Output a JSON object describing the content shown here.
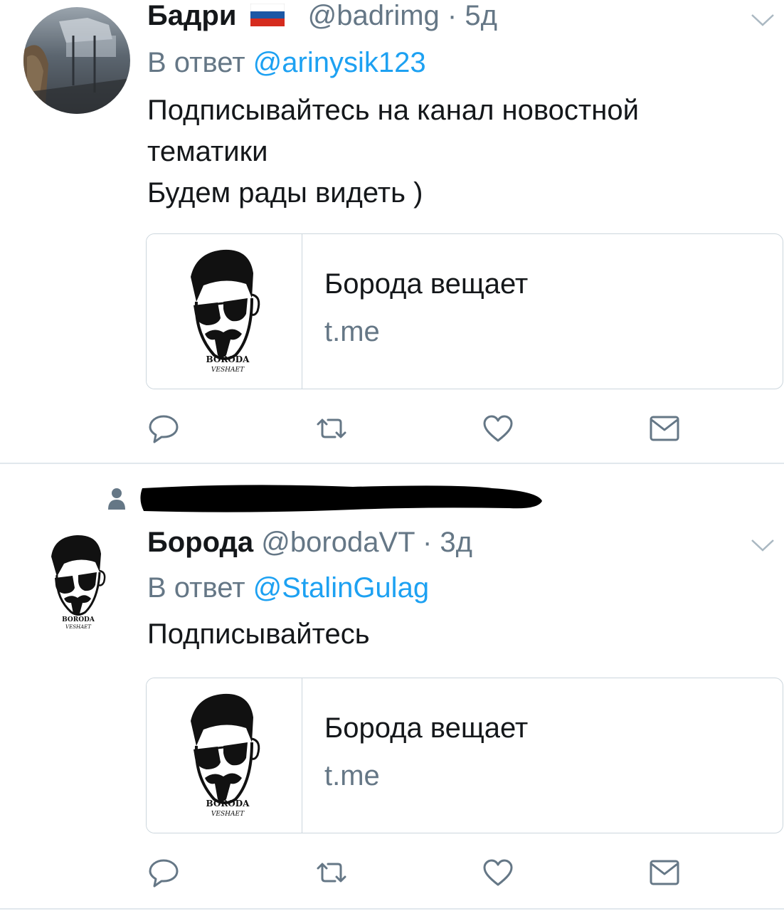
{
  "tweets": [
    {
      "display_name": "Бадри",
      "flag": "🇷🇺",
      "handle": "@badrimg",
      "dot": "·",
      "time": "5д",
      "reply_prefix": "В ответ",
      "reply_to": "@arinysik123",
      "text": "Подписывайтесь на канал новостной\nтематики\nБудем рады видеть )",
      "card": {
        "title": "Борода вещает",
        "domain": "t.me",
        "logo_text_top": "BORODA",
        "logo_text_bottom": "VESHAET"
      }
    },
    {
      "display_name": "Борода",
      "handle": "@borodaVT",
      "dot": "·",
      "time": "3д",
      "reply_prefix": "В ответ",
      "reply_to": "@StalinGulag",
      "text": "Подписывайтесь",
      "avatar_text_top": "BORODA",
      "avatar_text_bottom": "VESHAET",
      "card": {
        "title": "Борода вещает",
        "domain": "t.me",
        "logo_text_top": "BORODA",
        "logo_text_bottom": "VESHAET"
      }
    }
  ],
  "icons": {
    "reply": "reply-icon",
    "retweet": "retweet-icon",
    "like": "heart-icon",
    "dm": "envelope-icon",
    "more": "chevron-down-icon",
    "context": "person-icon"
  },
  "colors": {
    "text": "#14171a",
    "secondary": "#657786",
    "link": "#1da1f2",
    "border": "#ccd6dd",
    "divider": "#e1e8ed"
  }
}
